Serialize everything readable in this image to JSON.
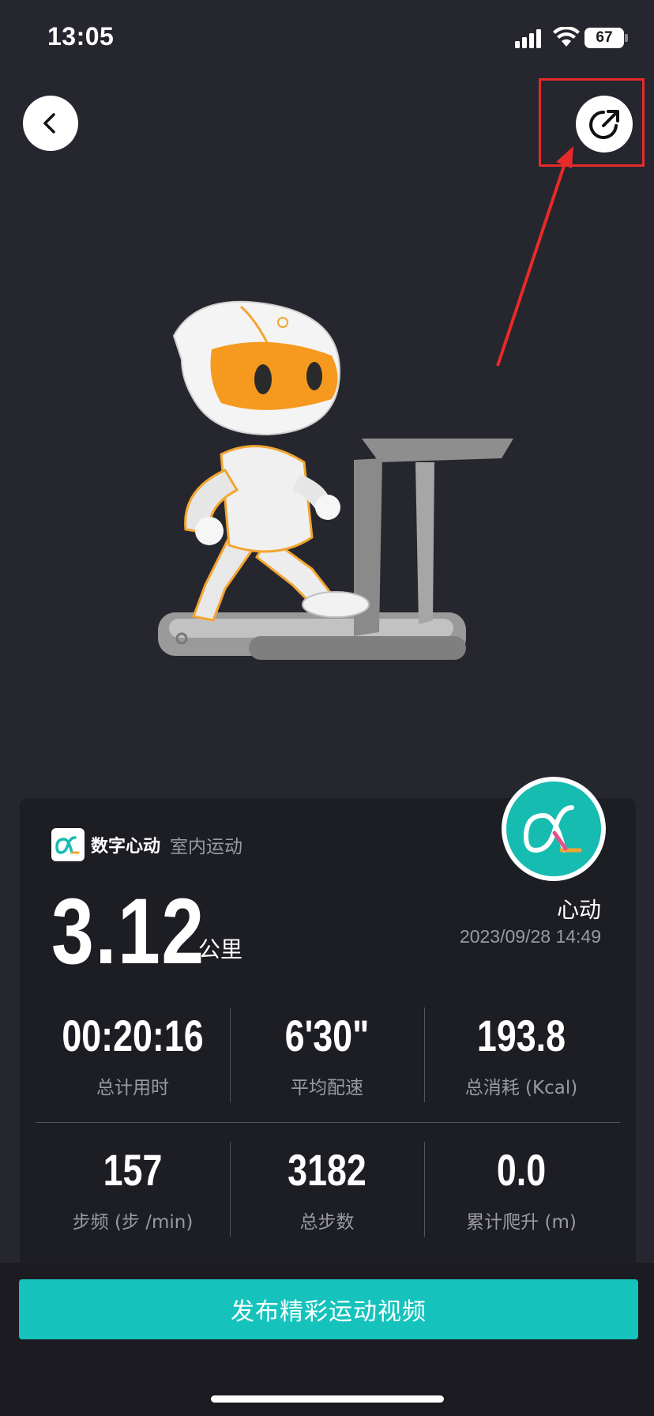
{
  "status_bar": {
    "time": "13:05",
    "battery": "67"
  },
  "card": {
    "brand_name": "数字心动",
    "activity_type": "室内运动",
    "distance": "3.12",
    "distance_unit": "公里",
    "user_name": "心动",
    "date": "2023/09/28 14:49",
    "metrics": [
      {
        "value": "00:20:16",
        "label": "总计用时"
      },
      {
        "value": "6'30\"",
        "label": "平均配速"
      },
      {
        "value": "193.8",
        "label": "总消耗 (Kcal)"
      },
      {
        "value": "157",
        "label": "步频 (步 /min)"
      },
      {
        "value": "3182",
        "label": "总步数"
      },
      {
        "value": "0.0",
        "label": "累计爬升 (m)"
      }
    ]
  },
  "publish_button_label": "发布精彩运动视频",
  "colors": {
    "background": "#26262f",
    "card": "#1d1d24",
    "accent": "#16c3bc",
    "annotation": "#e82a2a",
    "mascot_orange": "#f59a1f"
  },
  "icons": {
    "back": "chevron-left-icon",
    "share": "share-out-icon",
    "brand": "alpha-logo-icon",
    "mascot": "running-mascot-illustration"
  }
}
